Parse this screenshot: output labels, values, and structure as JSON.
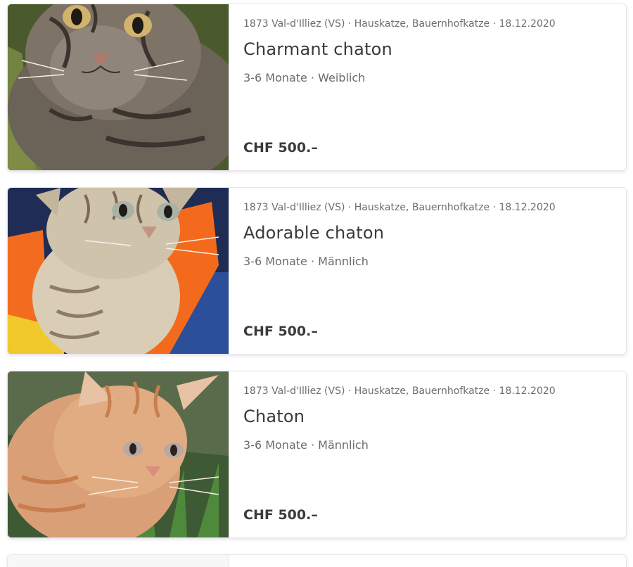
{
  "listings": [
    {
      "meta": "1873 Val-d'Illiez (VS) · Hauskatze, Bauernhofkatze · 18.12.2020",
      "title": "Charmant chaton",
      "details": "3-6 Monate · Weiblich",
      "price": "CHF 500.–",
      "photo": "tabby-kitten-photo"
    },
    {
      "meta": "1873 Val-d'Illiez (VS) · Hauskatze, Bauernhofkatze · 18.12.2020",
      "title": "Adorable chaton",
      "details": "3-6 Monate · Männlich",
      "price": "CHF 500.–",
      "photo": "light-tabby-kitten-photo"
    },
    {
      "meta": "1873 Val-d'Illiez (VS) · Hauskatze, Bauernhofkatze · 18.12.2020",
      "title": "Chaton",
      "details": "3-6 Monate · Männlich",
      "price": "CHF 500.–",
      "photo": "orange-kitten-photo"
    }
  ]
}
